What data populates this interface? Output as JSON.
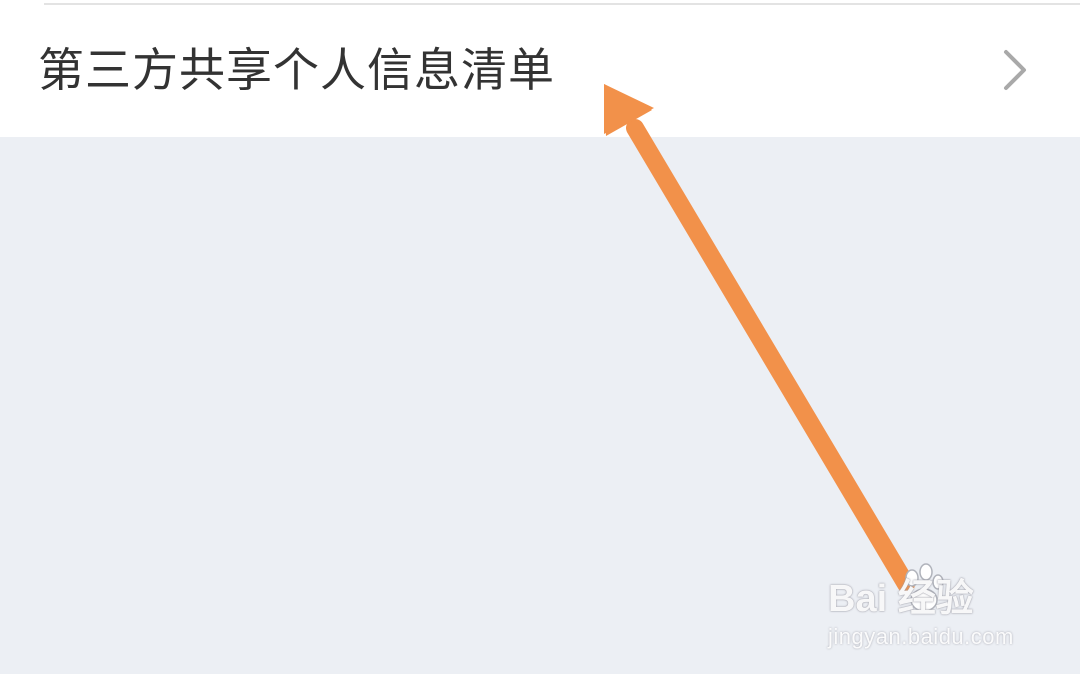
{
  "list": {
    "items": [
      {
        "label": "第三方共享个人信息清单",
        "icon": "chevron-right-icon"
      }
    ]
  },
  "annotation": {
    "icon": "arrow-icon",
    "color": "#f2914a"
  },
  "watermark": {
    "brand": "Bai  经验",
    "site": "jingyan.baidu.com",
    "icon": "paw-icon"
  },
  "colors": {
    "background": "#eceff4",
    "card": "#ffffff",
    "text": "#333333",
    "chevron": "#a9a9a9",
    "divider": "#e3e3e3"
  }
}
